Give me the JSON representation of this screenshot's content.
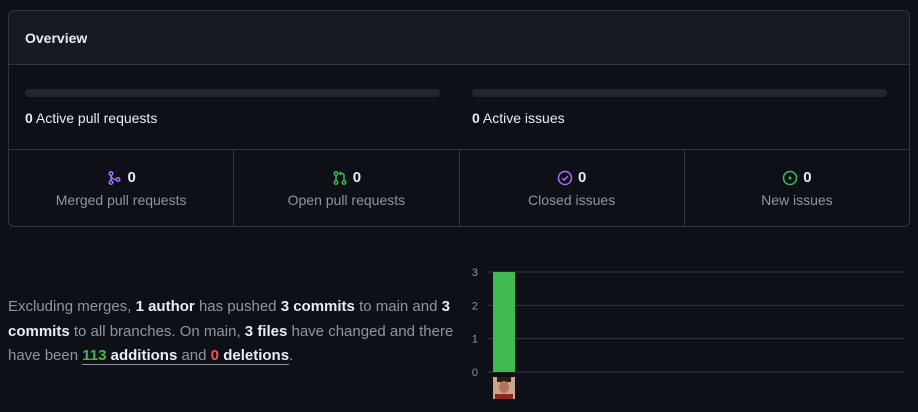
{
  "overview": {
    "title": "Overview",
    "active_pull_requests": {
      "count": "0",
      "label": "Active pull requests",
      "progress": 0
    },
    "active_issues": {
      "count": "0",
      "label": "Active issues",
      "progress": 0
    },
    "stats": [
      {
        "icon": "merged-pr-icon",
        "count": "0",
        "label": "Merged pull requests",
        "color": "#a371f7"
      },
      {
        "icon": "open-pr-icon",
        "count": "0",
        "label": "Open pull requests",
        "color": "#3fb950"
      },
      {
        "icon": "closed-issue-icon",
        "count": "0",
        "label": "Closed issues",
        "color": "#a371f7"
      },
      {
        "icon": "new-issue-icon",
        "count": "0",
        "label": "New issues",
        "color": "#3fb950"
      }
    ]
  },
  "summary": {
    "prefix": "Excluding merges,",
    "authors": "1 author",
    "pushed": "has pushed",
    "commits_main": "3 commits",
    "to_main": "to main and",
    "commits_all": "3 commits",
    "to_all": "to all branches. On main,",
    "files_count": "3",
    "files_word": "files",
    "changed": "have changed and there have been",
    "additions_count": "113",
    "additions_word": "additions",
    "and": "and",
    "deletions_count": "0",
    "deletions_word": "deletions",
    "end": "."
  },
  "colors": {
    "addition": "#3fb950",
    "deletion": "#f85149",
    "bar": "#3fb950"
  },
  "chart_data": {
    "type": "bar",
    "categories": [
      "contributor-avatar"
    ],
    "values": [
      3
    ],
    "yticks": [
      "0",
      "1",
      "2",
      "3"
    ],
    "ylim": [
      0,
      3
    ],
    "grid": true
  }
}
